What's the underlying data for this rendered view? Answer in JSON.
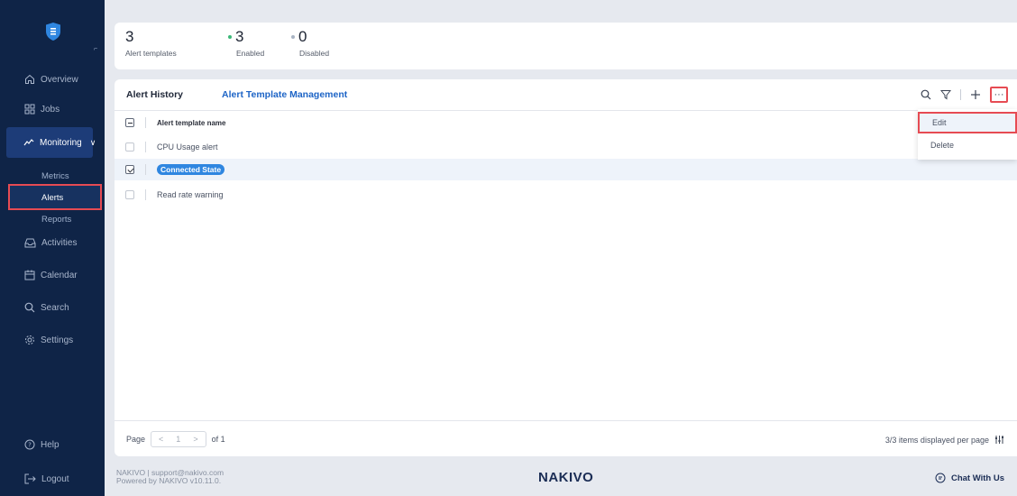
{
  "sidebar": {
    "nav": [
      {
        "label": "Overview",
        "icon": "home-icon"
      },
      {
        "label": "Jobs",
        "icon": "grid-icon"
      },
      {
        "label": "Monitoring",
        "icon": "pulse-icon"
      },
      {
        "label": "Activities",
        "icon": "inbox-icon"
      },
      {
        "label": "Calendar",
        "icon": "calendar-icon"
      },
      {
        "label": "Search",
        "icon": "search-icon"
      },
      {
        "label": "Settings",
        "icon": "gear-icon"
      }
    ],
    "sub": [
      "Metrics",
      "Alerts",
      "Reports"
    ],
    "help": "Help",
    "logout": "Logout"
  },
  "stats": [
    {
      "value": "3",
      "label": "Alert templates"
    },
    {
      "value": "3",
      "label": "Enabled",
      "dot_color": "#3cb878"
    },
    {
      "value": "0",
      "label": "Disabled",
      "dot_color": "#a9b4c4"
    }
  ],
  "tabs": [
    "Alert History",
    "Alert Template Management"
  ],
  "table": {
    "header": "Alert template name",
    "rows": [
      "CPU Usage alert",
      "Connected State",
      "Read rate warning"
    ]
  },
  "menu": [
    "Edit",
    "Delete"
  ],
  "pager": {
    "label": "Page",
    "current": "1",
    "of": "of 1"
  },
  "items_info": "3/3 items displayed per page",
  "footer": {
    "line1": "NAKIVO | support@nakivo.com",
    "line2": "Powered by NAKIVO v10.11.0.",
    "brand": "NAKIVO",
    "chat": "Chat With Us"
  },
  "colors": {
    "sidebar": "#0f2447",
    "accent": "#1d64c6",
    "highlight": "#e64b53"
  }
}
